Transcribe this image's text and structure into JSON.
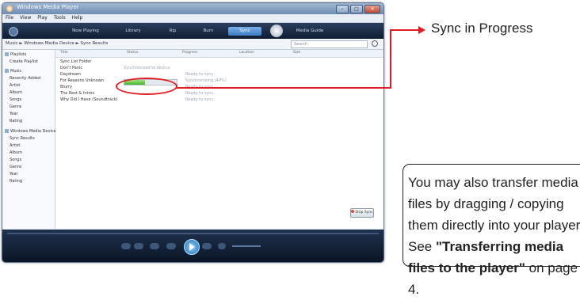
{
  "player": {
    "title": "Windows Media Player",
    "menu": [
      "File",
      "View",
      "Play",
      "Tools",
      "Help"
    ],
    "tabs": [
      "Now Playing",
      "Library",
      "Rip",
      "Burn",
      "Sync",
      "Media Guide"
    ],
    "active_tab": "Sync",
    "address": "Music  ►  Windows Media Device  ►  Sync Results",
    "search_placeholder": "Search",
    "nav_items": [
      "Playlists",
      "Create Playlist",
      "Music",
      "Recently Added",
      "Artist",
      "Album",
      "Songs",
      "Genre",
      "Year",
      "Rating",
      "Windows Media Device",
      "Sync Results",
      "Artist",
      "Album",
      "Songs",
      "Genre",
      "Year",
      "Rating"
    ],
    "columns": [
      "Title",
      "Status",
      "Progress",
      "Location",
      "Size"
    ],
    "rows": [
      {
        "title": "Sync List Folder",
        "status": ""
      },
      {
        "title": "Don't Panic",
        "status": "Synchronized to device"
      },
      {
        "title": "Daydream",
        "status": "Ready to sync"
      },
      {
        "title": "For Reasons Unknown",
        "status": "Synchronizing (40%)"
      },
      {
        "title": "Blurry",
        "status": "Ready to sync"
      },
      {
        "title": "The Rest & Intros",
        "status": "Ready to sync"
      },
      {
        "title": "Why Did I Have (Soundtrack)",
        "status": "Ready to sync"
      }
    ],
    "sync_progress": 0.4,
    "sync_button": "Stop Sync"
  },
  "annotation": {
    "callout_label": "Sync in Progress",
    "accent_color": "#e21b22",
    "note_lines": [
      "You may also transfer media",
      "files by dragging / copying",
      "them directly into your player."
    ],
    "note_see": "See ",
    "note_bold": "\"Transferring media files to the player\"",
    "note_tail": " on page 4."
  }
}
